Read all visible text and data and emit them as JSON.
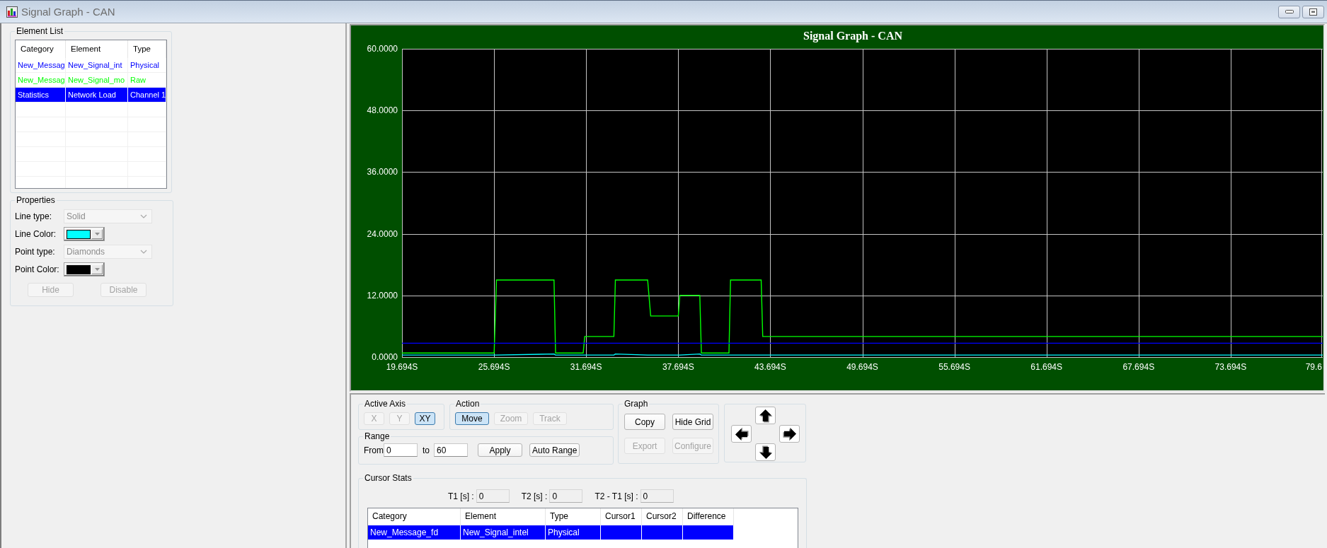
{
  "window": {
    "title": "Signal Graph - CAN"
  },
  "element_list": {
    "title": "Element List",
    "columns": [
      "Category",
      "Element",
      "Type"
    ],
    "rows": [
      {
        "cells": [
          "New_Messag",
          "New_Signal_int",
          "Physical"
        ],
        "color": "#0000ff",
        "selected": false
      },
      {
        "cells": [
          "New_Messag",
          "New_Signal_mo",
          "Raw"
        ],
        "color": "#00ff00",
        "selected": false
      },
      {
        "cells": [
          "Statistics",
          "Network Load",
          "Channel 1"
        ],
        "selected": true
      }
    ]
  },
  "properties": {
    "title": "Properties",
    "fields": [
      {
        "kind": "select",
        "label": "Line type:",
        "value": "Solid",
        "disabled": true
      },
      {
        "kind": "color",
        "label": "Line Color:",
        "color": "#00ffff"
      },
      {
        "kind": "select",
        "label": "Point type:",
        "value": "Diamonds",
        "disabled": true
      },
      {
        "kind": "color",
        "label": "Point Color:",
        "color": "#000000"
      }
    ],
    "buttons": [
      {
        "label": "Hide",
        "disabled": true
      },
      {
        "label": "Disable",
        "disabled": true
      }
    ]
  },
  "graph": {
    "chart_data": {
      "type": "line",
      "title": "Signal Graph - CAN",
      "grid": true,
      "x": [
        19.694,
        25.7,
        25.85,
        29.6,
        29.7,
        31.5,
        31.6,
        33.5,
        33.6,
        35.7,
        35.9,
        37.7,
        37.8,
        39.1,
        39.2,
        41.0,
        41.1,
        43.1,
        43.2,
        79.694
      ],
      "series": [
        {
          "color": "#00ff00",
          "values": [
            0.8,
            0.8,
            15,
            15,
            0.8,
            0.8,
            4,
            4,
            15,
            15,
            8,
            8,
            12,
            12,
            0.8,
            0.8,
            15,
            15,
            4,
            4
          ]
        },
        {
          "color": "#0000ff",
          "values": [
            2.7,
            2.7,
            2.7,
            2.7,
            2.7,
            2.7,
            2.7,
            2.7,
            2.7,
            2.7,
            2.7,
            2.7,
            2.7,
            2.7,
            2.7,
            2.7,
            2.7,
            2.7,
            2.7,
            2.7
          ]
        },
        {
          "color": "#00ffff",
          "values": [
            0.4,
            0.4,
            0.4,
            0.6,
            0.4,
            0.4,
            0.4,
            0.4,
            0.6,
            0.4,
            0.4,
            0.4,
            0.4,
            0.6,
            0.4,
            0.4,
            0.4,
            0.4,
            0.4,
            0.4
          ]
        }
      ],
      "xlim": [
        19.694,
        79.694
      ],
      "ylim": [
        0,
        60
      ],
      "xticks": [
        {
          "value": 19.694,
          "label": "19.694S"
        },
        {
          "value": 25.694,
          "label": "25.694S"
        },
        {
          "value": 31.694,
          "label": "31.694S"
        },
        {
          "value": 37.694,
          "label": "37.694S"
        },
        {
          "value": 43.694,
          "label": "43.694S"
        },
        {
          "value": 49.694,
          "label": "49.694S"
        },
        {
          "value": 55.694,
          "label": "55.694S"
        },
        {
          "value": 61.694,
          "label": "61.694S"
        },
        {
          "value": 67.694,
          "label": "67.694S"
        },
        {
          "value": 73.694,
          "label": "73.694S"
        },
        79.6
      ],
      "yticks": [
        {
          "value": 0,
          "label": "0.0000"
        },
        {
          "value": 12,
          "label": "12.0000"
        },
        {
          "value": 24,
          "label": "24.0000"
        },
        {
          "value": 36,
          "label": "36.0000"
        },
        {
          "value": 48,
          "label": "48.0000"
        },
        {
          "value": 60,
          "label": "60.0000"
        }
      ]
    }
  },
  "controls": {
    "active_axis": {
      "title": "Active Axis",
      "buttons": [
        {
          "label": "X",
          "selected": false,
          "disabled": true
        },
        {
          "label": "Y",
          "selected": false,
          "disabled": true
        },
        {
          "label": "XY",
          "selected": true,
          "disabled": false
        }
      ]
    },
    "action": {
      "title": "Action",
      "buttons": [
        {
          "label": "Move",
          "selected": true,
          "disabled": false
        },
        {
          "label": "Zoom",
          "selected": false,
          "disabled": true
        },
        {
          "label": "Track",
          "selected": false,
          "disabled": true
        }
      ]
    },
    "range": {
      "title": "Range",
      "from_label": "From",
      "from_value": "0",
      "to_label": "to",
      "to_value": "60",
      "buttons": [
        {
          "label": "Apply"
        },
        {
          "label": "Auto Range"
        }
      ]
    },
    "graph": {
      "title": "Graph",
      "buttons": [
        {
          "label": "Copy",
          "disabled": false
        },
        {
          "label": "Hide Grid",
          "disabled": false
        },
        {
          "label": "Export",
          "disabled": true
        },
        {
          "label": "Configure",
          "disabled": true
        }
      ]
    }
  },
  "cursor_stats": {
    "title": "Cursor Stats",
    "readouts": [
      {
        "label": "T1 [s] :",
        "value": "0"
      },
      {
        "label": "T2 [s] :",
        "value": "0"
      },
      {
        "label": "T2 - T1 [s] :",
        "value": "0"
      }
    ],
    "columns": [
      "Category",
      "Element",
      "Type",
      "Cursor1",
      "Cursor2",
      "Difference"
    ],
    "rows": [
      {
        "cells": [
          "New_Message_fd",
          "New_Signal_intel",
          "Physical"
        ],
        "selected": true
      }
    ]
  }
}
